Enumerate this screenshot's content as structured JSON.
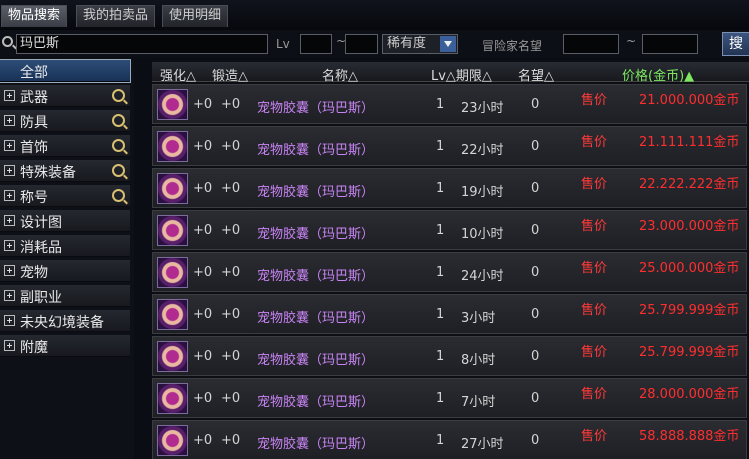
{
  "tabs": [
    {
      "label": "物品搜索",
      "active": true
    },
    {
      "label": "我的拍卖品",
      "active": false
    },
    {
      "label": "使用明细",
      "active": false
    }
  ],
  "search": {
    "query": "玛巴斯",
    "lv_label": "Lv",
    "tilde": "~",
    "rarity_label": "稀有度",
    "adventurer_label": "冒险家名望",
    "button_label": "搜"
  },
  "sidebar": {
    "items": [
      {
        "label": "全部",
        "selected": true,
        "zoom": false
      },
      {
        "label": "武器",
        "selected": false,
        "zoom": true
      },
      {
        "label": "防具",
        "selected": false,
        "zoom": true
      },
      {
        "label": "首饰",
        "selected": false,
        "zoom": true
      },
      {
        "label": "特殊装备",
        "selected": false,
        "zoom": true
      },
      {
        "label": "称号",
        "selected": false,
        "zoom": true
      },
      {
        "label": "设计图",
        "selected": false,
        "zoom": false
      },
      {
        "label": "消耗品",
        "selected": false,
        "zoom": false
      },
      {
        "label": "宠物",
        "selected": false,
        "zoom": false
      },
      {
        "label": "副职业",
        "selected": false,
        "zoom": false
      },
      {
        "label": "未央幻境装备",
        "selected": false,
        "zoom": false
      },
      {
        "label": "附魔",
        "selected": false,
        "zoom": false
      }
    ]
  },
  "table": {
    "headers": {
      "enhance": "强化△",
      "forge": "锻造△",
      "name": "名称△",
      "lv_period": "Lv△期限△",
      "fame": "名望△",
      "price": "价格(金币)▲"
    },
    "rows": [
      {
        "enhance": "+0",
        "forge": "+0",
        "name": "宠物胶囊（玛巴斯）",
        "lv": "1",
        "period": "23小时",
        "fame": "0",
        "sell": "售价",
        "price": "21.000.000金币"
      },
      {
        "enhance": "+0",
        "forge": "+0",
        "name": "宠物胶囊（玛巴斯）",
        "lv": "1",
        "period": "22小时",
        "fame": "0",
        "sell": "售价",
        "price": "21.111.111金币"
      },
      {
        "enhance": "+0",
        "forge": "+0",
        "name": "宠物胶囊（玛巴斯）",
        "lv": "1",
        "period": "19小时",
        "fame": "0",
        "sell": "售价",
        "price": "22.222.222金币"
      },
      {
        "enhance": "+0",
        "forge": "+0",
        "name": "宠物胶囊（玛巴斯）",
        "lv": "1",
        "period": "10小时",
        "fame": "0",
        "sell": "售价",
        "price": "23.000.000金币"
      },
      {
        "enhance": "+0",
        "forge": "+0",
        "name": "宠物胶囊（玛巴斯）",
        "lv": "1",
        "period": "24小时",
        "fame": "0",
        "sell": "售价",
        "price": "25.000.000金币"
      },
      {
        "enhance": "+0",
        "forge": "+0",
        "name": "宠物胶囊（玛巴斯）",
        "lv": "1",
        "period": "3小时",
        "fame": "0",
        "sell": "售价",
        "price": "25.799.999金币"
      },
      {
        "enhance": "+0",
        "forge": "+0",
        "name": "宠物胶囊（玛巴斯）",
        "lv": "1",
        "period": "8小时",
        "fame": "0",
        "sell": "售价",
        "price": "25.799.999金币"
      },
      {
        "enhance": "+0",
        "forge": "+0",
        "name": "宠物胶囊（玛巴斯）",
        "lv": "1",
        "period": "7小时",
        "fame": "0",
        "sell": "售价",
        "price": "28.000.000金币"
      },
      {
        "enhance": "+0",
        "forge": "+0",
        "name": "宠物胶囊（玛巴斯）",
        "lv": "1",
        "period": "27小时",
        "fame": "0",
        "sell": "售价",
        "price": "58.888.888金币"
      }
    ]
  },
  "icons": {
    "search": "magnifier-icon",
    "expand": "plus-box-icon",
    "zoom": "zoom-in-icon",
    "item": "pet-capsule-icon",
    "dropdown": "chevron-down-icon"
  },
  "colors": {
    "item_name": "#c884f5",
    "price": "#ff2e2e",
    "price_header": "#7ee860",
    "selected_category": "#2d4d77"
  }
}
